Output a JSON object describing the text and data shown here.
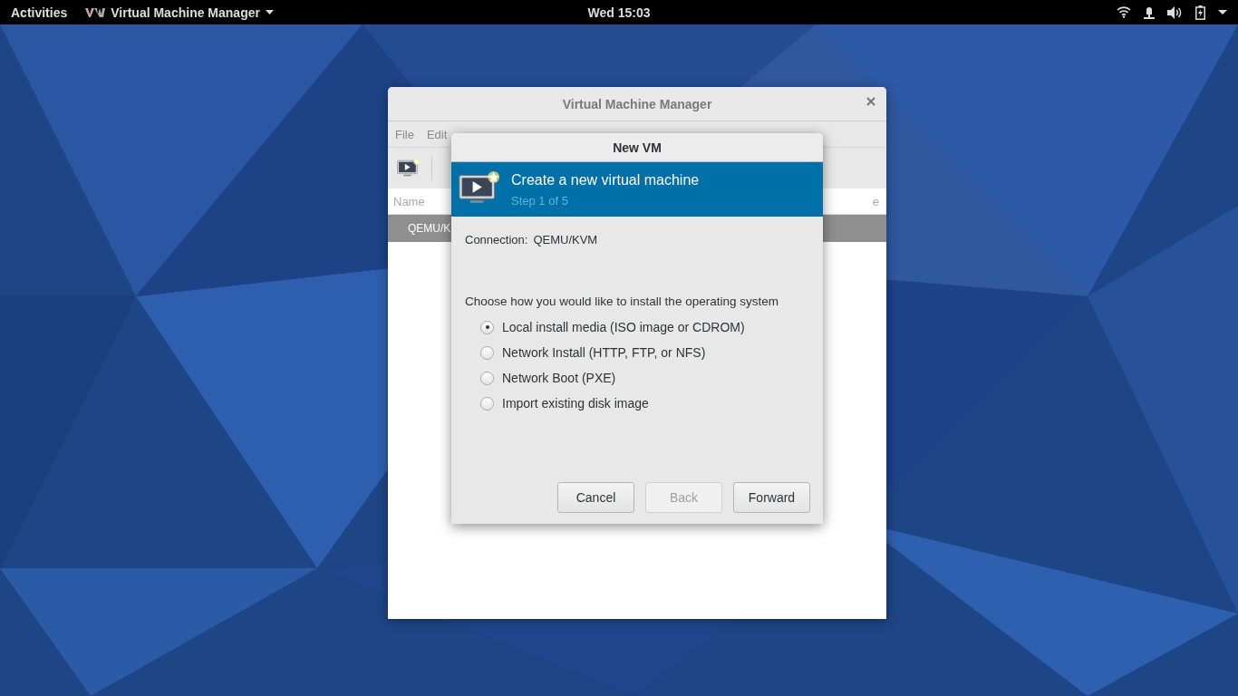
{
  "top_bar": {
    "activities": "Activities",
    "app_menu": "Virtual Machine Manager",
    "clock": "Wed 15:03"
  },
  "main_window": {
    "title": "Virtual Machine Manager",
    "menu": [
      "File",
      "Edit"
    ],
    "columns": [
      {
        "label": "Name"
      },
      {
        "label": "e"
      }
    ],
    "rows": [
      {
        "name": "QEMU/K",
        "selected": true
      }
    ]
  },
  "dialog": {
    "title": "New VM",
    "header_title": "Create a new virtual machine",
    "header_step": "Step 1 of 5",
    "connection_label": "Connection:",
    "connection_value": "QEMU/KVM",
    "prompt": "Choose how you would like to install the operating system",
    "options": [
      {
        "label": "Local install media (ISO image or CDROM)",
        "selected": true
      },
      {
        "label": "Network Install (HTTP, FTP, or NFS)",
        "selected": false
      },
      {
        "label": "Network Boot (PXE)",
        "selected": false
      },
      {
        "label": "Import existing disk image",
        "selected": false
      }
    ],
    "buttons": [
      {
        "label": "Cancel",
        "disabled": false
      },
      {
        "label": "Back",
        "disabled": true
      },
      {
        "label": "Forward",
        "disabled": false
      }
    ]
  }
}
